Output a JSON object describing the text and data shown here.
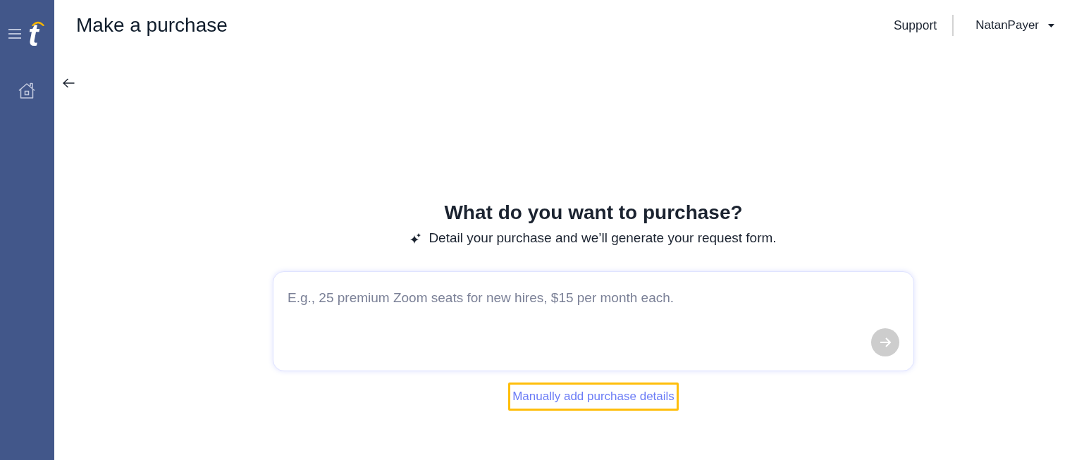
{
  "sidebar": {
    "logo": "t"
  },
  "header": {
    "title": "Make a purchase",
    "support_link": "Support",
    "user_menu": {
      "label": "NatanPayer"
    }
  },
  "prompt": {
    "heading": "What do you want to purchase?",
    "subtitle": "Detail your purchase and we’ll generate your request form.",
    "placeholder": "E.g., 25 premium Zoom seats for new hires, $15 per month each.",
    "submit_button": {
      "disabled": true
    }
  },
  "manual_link": {
    "label": "Manually add purchase details",
    "highlighted": true
  }
}
